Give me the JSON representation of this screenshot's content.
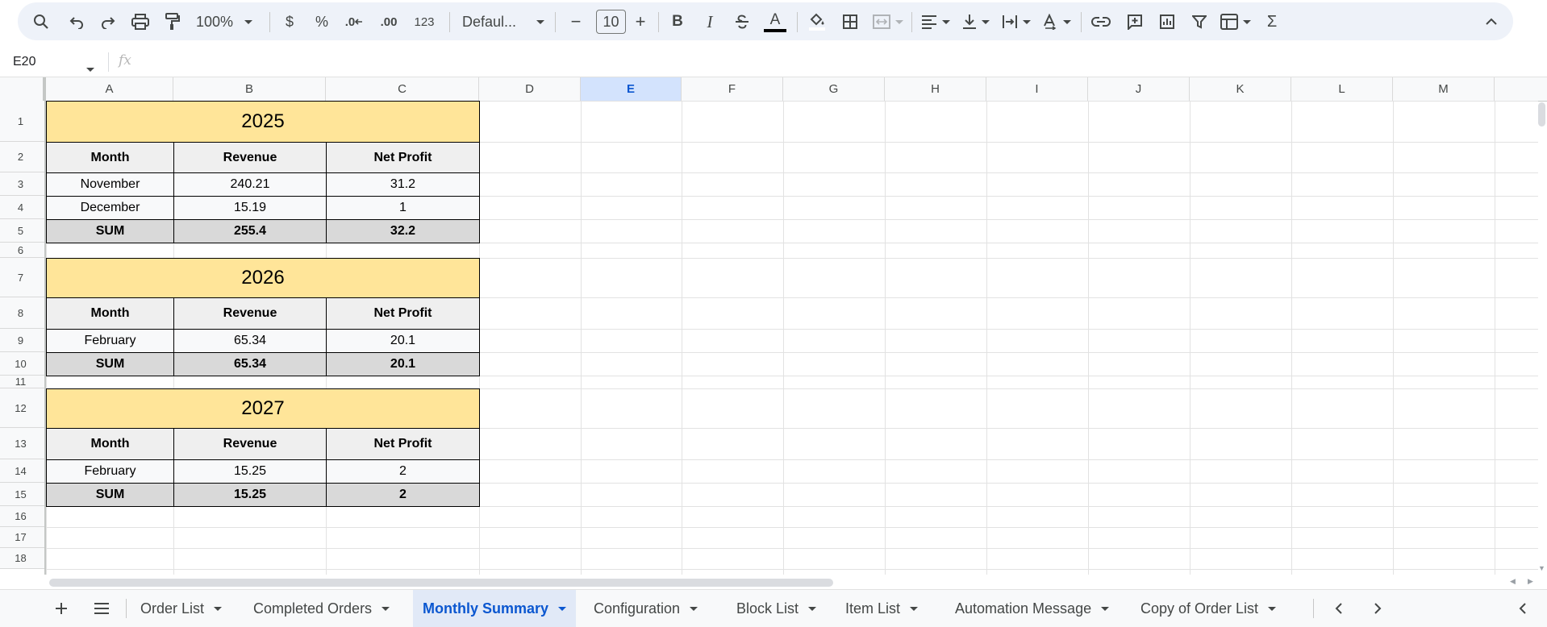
{
  "toolbar": {
    "zoom": "100%",
    "currency": "$",
    "percent": "%",
    "decrease_decimal": ".0",
    "increase_decimal": ".00",
    "number_format": "123",
    "font": "Defaul...",
    "font_size": "10",
    "minus": "−",
    "plus": "+",
    "bold": "B",
    "italic": "I",
    "text_color_letter": "A",
    "sum_symbol": "Σ"
  },
  "formula_bar": {
    "cell_ref": "E20",
    "fx": "fx"
  },
  "columns": [
    "A",
    "B",
    "C",
    "D",
    "E",
    "F",
    "G",
    "H",
    "I",
    "J",
    "K",
    "L",
    "M"
  ],
  "selected_column": "E",
  "rows": [
    "1",
    "2",
    "3",
    "4",
    "5",
    "6",
    "7",
    "8",
    "9",
    "10",
    "11",
    "12",
    "13",
    "14",
    "15",
    "16",
    "17",
    "18"
  ],
  "tables": [
    {
      "year": "2025",
      "headers": [
        "Month",
        "Revenue",
        "Net Profit"
      ],
      "data": [
        [
          "November",
          "240.21",
          "31.2"
        ],
        [
          "December",
          "15.19",
          "1"
        ]
      ],
      "sum": [
        "SUM",
        "255.4",
        "32.2"
      ]
    },
    {
      "year": "2026",
      "headers": [
        "Month",
        "Revenue",
        "Net Profit"
      ],
      "data": [
        [
          "February",
          "65.34",
          "20.1"
        ]
      ],
      "sum": [
        "SUM",
        "65.34",
        "20.1"
      ]
    },
    {
      "year": "2027",
      "headers": [
        "Month",
        "Revenue",
        "Net Profit"
      ],
      "data": [
        [
          "February",
          "15.25",
          "2"
        ]
      ],
      "sum": [
        "SUM",
        "15.25",
        "2"
      ]
    }
  ],
  "sheet_tabs": [
    {
      "label": "Order List",
      "active": false
    },
    {
      "label": "Completed Orders",
      "active": false
    },
    {
      "label": "Monthly Summary",
      "active": true
    },
    {
      "label": "Configuration",
      "active": false
    },
    {
      "label": "Block List",
      "active": false
    },
    {
      "label": "Item List",
      "active": false
    },
    {
      "label": "Automation Message",
      "active": false
    },
    {
      "label": "Copy of Order List",
      "active": false
    }
  ],
  "colors": {
    "year_fill": "#ffe599",
    "header_fill": "#efefef",
    "sum_fill": "#d9d9d9",
    "accent": "#0b57d0",
    "selected_header": "#d3e3fd"
  }
}
